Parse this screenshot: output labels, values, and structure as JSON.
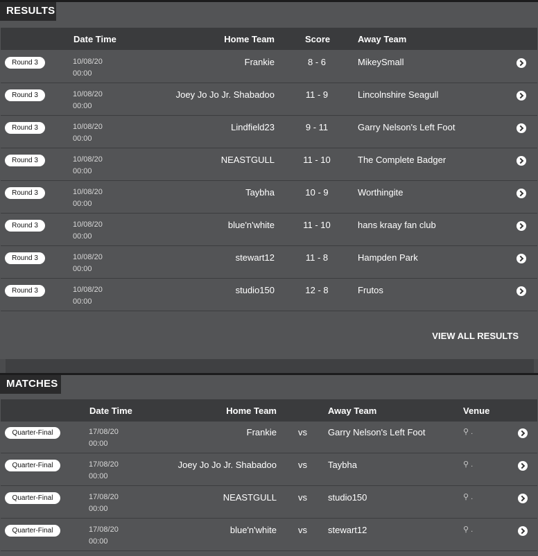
{
  "results": {
    "title": "RESULTS",
    "headers": {
      "datetime": "Date Time",
      "home": "Home Team",
      "score": "Score",
      "away": "Away Team"
    },
    "rows": [
      {
        "round": "Round 3",
        "date": "10/08/20",
        "time": "00:00",
        "home": "Frankie",
        "score": "8 - 6",
        "away": "MikeySmall"
      },
      {
        "round": "Round 3",
        "date": "10/08/20",
        "time": "00:00",
        "home": "Joey Jo Jo Jr. Shabadoo",
        "score": "11 - 9",
        "away": "Lincolnshire Seagull"
      },
      {
        "round": "Round 3",
        "date": "10/08/20",
        "time": "00:00",
        "home": "Lindfield23",
        "score": "9 - 11",
        "away": "Garry Nelson's Left Foot"
      },
      {
        "round": "Round 3",
        "date": "10/08/20",
        "time": "00:00",
        "home": "NEASTGULL",
        "score": "11 - 10",
        "away": "The Complete Badger"
      },
      {
        "round": "Round 3",
        "date": "10/08/20",
        "time": "00:00",
        "home": "Taybha",
        "score": "10 - 9",
        "away": "Worthingite"
      },
      {
        "round": "Round 3",
        "date": "10/08/20",
        "time": "00:00",
        "home": "blue'n'white",
        "score": "11 - 10",
        "away": "hans kraay fan club"
      },
      {
        "round": "Round 3",
        "date": "10/08/20",
        "time": "00:00",
        "home": "stewart12",
        "score": "11 - 8",
        "away": "Hampden Park"
      },
      {
        "round": "Round 3",
        "date": "10/08/20",
        "time": "00:00",
        "home": "studio150",
        "score": "12 - 8",
        "away": "Frutos"
      }
    ],
    "view_all_label": "VIEW ALL RESULTS"
  },
  "matches": {
    "title": "MATCHES",
    "headers": {
      "datetime": "Date Time",
      "home": "Home Team",
      "away": "Away Team",
      "venue": "Venue"
    },
    "rows": [
      {
        "round": "Quarter-Final",
        "date": "17/08/20",
        "time": "00:00",
        "home": "Frankie",
        "vs": "vs",
        "away": "Garry Nelson's Left Foot",
        "venue": "."
      },
      {
        "round": "Quarter-Final",
        "date": "17/08/20",
        "time": "00:00",
        "home": "Joey Jo Jo Jr. Shabadoo",
        "vs": "vs",
        "away": "Taybha",
        "venue": "."
      },
      {
        "round": "Quarter-Final",
        "date": "17/08/20",
        "time": "00:00",
        "home": "NEASTGULL",
        "vs": "vs",
        "away": "studio150",
        "venue": "."
      },
      {
        "round": "Quarter-Final",
        "date": "17/08/20",
        "time": "00:00",
        "home": "blue'n'white",
        "vs": "vs",
        "away": "stewart12",
        "venue": "."
      }
    ]
  },
  "icons": {
    "row_link": "chevron-right-circle-icon",
    "venue": "map-pin-icon"
  }
}
